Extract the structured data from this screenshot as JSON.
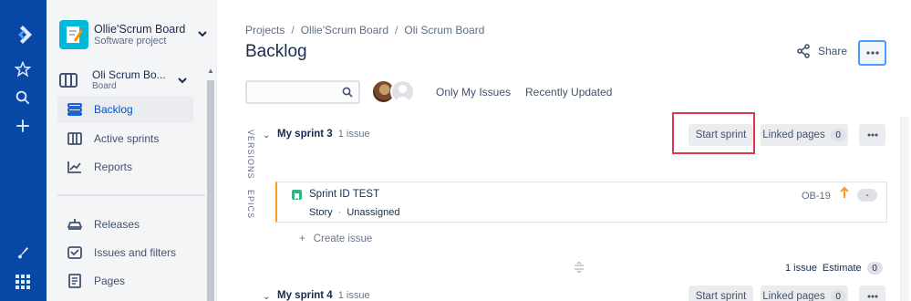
{
  "sidebar": {
    "project": {
      "name": "Ollie'Scrum Board",
      "type": "Software project"
    },
    "board": {
      "name": "Oli Scrum Bo...",
      "sub": "Board"
    },
    "items": [
      {
        "label": "Backlog",
        "icon": "backlog-icon"
      },
      {
        "label": "Active sprints",
        "icon": "active-sprints-icon"
      },
      {
        "label": "Reports",
        "icon": "reports-icon"
      },
      {
        "label": "Releases",
        "icon": "releases-icon"
      },
      {
        "label": "Issues and filters",
        "icon": "issues-filters-icon"
      },
      {
        "label": "Pages",
        "icon": "pages-icon"
      }
    ]
  },
  "breadcrumbs": [
    "Projects",
    "Ollie'Scrum Board",
    "Oli Scrum Board"
  ],
  "breadcrumb_sep": "/",
  "page_title": "Backlog",
  "share_label": "Share",
  "filters": {
    "only_my_issues": "Only My Issues",
    "recently_updated": "Recently Updated"
  },
  "side_tabs": {
    "versions": "VERSIONS",
    "epics": "EPICS"
  },
  "sprints": [
    {
      "name": "My sprint 3",
      "count": "1 issue",
      "start_label": "Start sprint",
      "linked_label": "Linked pages",
      "linked_count": "0",
      "issues": [
        {
          "summary": "Sprint ID TEST",
          "type": "Story",
          "sep": "·",
          "assignee": "Unassigned",
          "key": "OB-19",
          "estimate": "-"
        }
      ],
      "create_label": "Create issue",
      "footer_count": "1 issue",
      "footer_estimate_label": "Estimate",
      "footer_estimate": "0"
    },
    {
      "name": "My sprint 4",
      "count": "1 issue",
      "start_label": "Start sprint",
      "linked_label": "Linked pages",
      "linked_count": "0"
    }
  ],
  "colors": {
    "nav": "#0747a6",
    "highlight": "#e2384d",
    "priority": "#ff991f",
    "story": "#36b37e"
  }
}
